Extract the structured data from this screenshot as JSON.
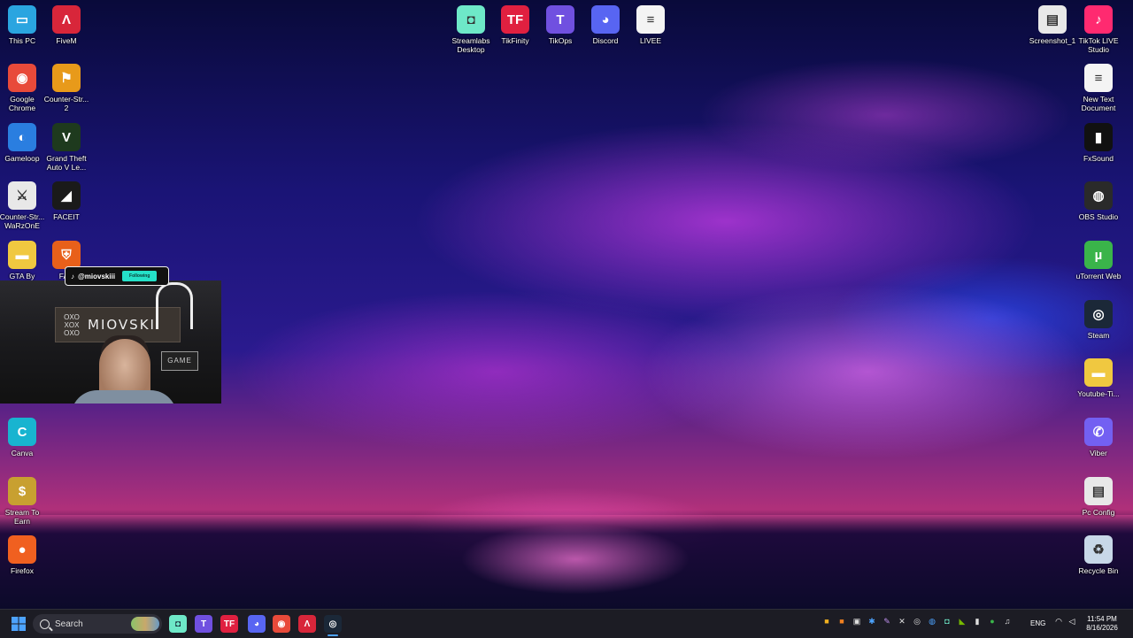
{
  "desktop": {
    "left_icons": [
      {
        "label": "This PC",
        "icon": "monitor-icon",
        "color": "#2aa5e0",
        "glyph": "▭"
      },
      {
        "label": "FiveM",
        "icon": "fivem-icon",
        "color": "#d8263a",
        "glyph": "Λ"
      },
      {
        "label": "Google Chrome",
        "icon": "chrome-icon",
        "color": "#e84a3a",
        "glyph": "◉"
      },
      {
        "label": "Counter-Str... 2",
        "icon": "counter-strike-2-icon",
        "color": "#e89a1a",
        "glyph": "⚑"
      },
      {
        "label": "Gameloop",
        "icon": "gameloop-icon",
        "color": "#2a7ee0",
        "glyph": "◐"
      },
      {
        "label": "Grand Theft Auto V Le...",
        "icon": "gta-v-icon",
        "color": "#1e3a1e",
        "glyph": "V"
      },
      {
        "label": "Counter-Str... WaRzOnE",
        "icon": "counter-strike-icon",
        "color": "#e8e8e8",
        "glyph": "⚔"
      },
      {
        "label": "FACEIT",
        "icon": "faceit-icon",
        "color": "#1a1a1a",
        "glyph": "◢"
      },
      {
        "label": "GTA By",
        "icon": "folder-icon",
        "color": "#f0c840",
        "glyph": "▬"
      },
      {
        "label": "FAC",
        "icon": "faceit-ac-icon",
        "color": "#e8601a",
        "glyph": "⛨"
      },
      {
        "label": "Canva",
        "icon": "canva-icon",
        "color": "#18b4d0",
        "glyph": "C"
      },
      {
        "label": "Stream To Earn",
        "icon": "stream-to-earn-icon",
        "color": "#c8a030",
        "glyph": "$"
      },
      {
        "label": "Firefox",
        "icon": "firefox-icon",
        "color": "#f06020",
        "glyph": "●"
      }
    ],
    "top_icons": [
      {
        "label": "Streamlabs Desktop",
        "icon": "streamlabs-icon",
        "color": "#6ee8c8",
        "glyph": "◘"
      },
      {
        "label": "TikFinity",
        "icon": "tikfinity-icon",
        "color": "#e02040",
        "glyph": "TF"
      },
      {
        "label": "TikOps",
        "icon": "tikops-icon",
        "color": "#7050e0",
        "glyph": "T"
      },
      {
        "label": "Discord",
        "icon": "discord-icon",
        "color": "#5865f2",
        "glyph": "◕"
      },
      {
        "label": "LIVEE",
        "icon": "text-document-icon",
        "color": "#f4f4f4",
        "glyph": "≡"
      }
    ],
    "right_icons": [
      {
        "label": "Screenshot_1",
        "icon": "screenshot-file-icon",
        "color": "#e8e8e8",
        "glyph": "▤"
      },
      {
        "label": "TikTok LIVE Studio",
        "icon": "tiktok-live-studio-icon",
        "color": "#ff2a70",
        "glyph": "♪"
      },
      {
        "label": "New Text Document",
        "icon": "text-document-icon",
        "color": "#f4f4f4",
        "glyph": "≡"
      },
      {
        "label": "FxSound",
        "icon": "fxsound-icon",
        "color": "#111111",
        "glyph": "▮"
      },
      {
        "label": "OBS Studio",
        "icon": "obs-studio-icon",
        "color": "#2a2a2a",
        "glyph": "◍"
      },
      {
        "label": "uTorrent Web",
        "icon": "utorrent-icon",
        "color": "#3ab44a",
        "glyph": "µ"
      },
      {
        "label": "Steam",
        "icon": "steam-icon",
        "color": "#1b2838",
        "glyph": "◎"
      },
      {
        "label": "Youtube-Ti...",
        "icon": "folder-icon",
        "color": "#f0c840",
        "glyph": "▬"
      },
      {
        "label": "Viber",
        "icon": "viber-icon",
        "color": "#7360f2",
        "glyph": "✆"
      },
      {
        "label": "Pc Config",
        "icon": "screenshot-file-icon",
        "color": "#e8e8e8",
        "glyph": "▤"
      },
      {
        "label": "Recycle Bin",
        "icon": "recycle-bin-icon",
        "color": "#c8d8e8",
        "glyph": "♻"
      }
    ]
  },
  "webcam": {
    "tiktok_handle": "@miovskiii",
    "follow_label": "Following",
    "sign_text": "MIOVSKI",
    "sign_xo": "OXO XOX OXO",
    "game_text": "GAME"
  },
  "taskbar": {
    "search_label": "Search",
    "apps": [
      {
        "icon": "streamlabs-icon",
        "color": "#6ee8c8",
        "glyph": "◘"
      },
      {
        "icon": "tikops-icon",
        "color": "#7050e0",
        "glyph": "T"
      },
      {
        "icon": "tikfinity-icon",
        "color": "#e02040",
        "glyph": "TF"
      },
      {
        "icon": "discord-icon",
        "color": "#5865f2",
        "glyph": "◕"
      },
      {
        "icon": "chrome-icon",
        "color": "#e84a3a",
        "glyph": "◉"
      },
      {
        "icon": "fivem-icon",
        "color": "#d8263a",
        "glyph": "Λ"
      },
      {
        "icon": "steam-icon",
        "color": "#1b2838",
        "glyph": "◎"
      }
    ],
    "tray": [
      {
        "icon": "tray-app-icon-1",
        "color": "#f0b020",
        "glyph": "■"
      },
      {
        "icon": "tray-app-icon-2",
        "color": "#f08020",
        "glyph": "■"
      },
      {
        "icon": "tray-app-icon-3",
        "color": "#e0e0e0",
        "glyph": "▣"
      },
      {
        "icon": "bluetooth-icon",
        "color": "#4da3ff",
        "glyph": "✱"
      },
      {
        "icon": "pen-icon",
        "color": "#c090f0",
        "glyph": "✎"
      },
      {
        "icon": "mute-icon",
        "color": "#e0e0e0",
        "glyph": "✕"
      },
      {
        "icon": "steam-tray-icon",
        "color": "#e0e0e0",
        "glyph": "◎"
      },
      {
        "icon": "network-app-icon",
        "color": "#4da3ff",
        "glyph": "◍"
      },
      {
        "icon": "streamlabs-tray-icon",
        "color": "#6ee8c8",
        "glyph": "◘"
      },
      {
        "icon": "nvidia-icon",
        "color": "#76b900",
        "glyph": "◣"
      },
      {
        "icon": "audio-levels-icon",
        "color": "#e0e0e0",
        "glyph": "▮"
      },
      {
        "icon": "status-dot-icon",
        "color": "#3ab44a",
        "glyph": "●"
      },
      {
        "icon": "microphone-icon",
        "color": "#e0e0e0",
        "glyph": "♫"
      }
    ],
    "language": "ENG",
    "time": "11:54 PM",
    "date": "8/16/2026"
  }
}
